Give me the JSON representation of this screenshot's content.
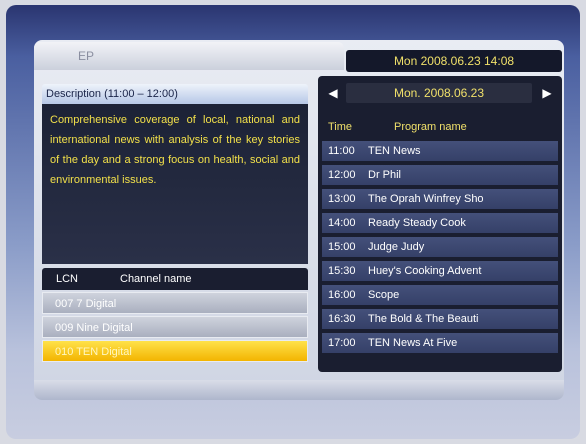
{
  "header": {
    "tab_label": "EP",
    "datetime": "Mon  2008.06.23  14:08"
  },
  "description": {
    "header": "Description (11:00 – 12:00)",
    "text": "Comprehensive coverage of local, national and international news with analysis of the key stories of the day and a strong focus on health, social and environmental issues."
  },
  "channels": {
    "columns": [
      "LCN",
      "Channel name"
    ],
    "rows": [
      {
        "label": "007  7 Digital"
      },
      {
        "label": "009  Nine Digital"
      },
      {
        "label": "010  TEN Digital"
      }
    ]
  },
  "guide": {
    "date": "Mon.    2008.06.23",
    "columns": [
      "Time",
      "Program name"
    ],
    "programs": [
      {
        "time": "11:00",
        "name": "TEN News"
      },
      {
        "time": "12:00",
        "name": "Dr Phil"
      },
      {
        "time": "13:00",
        "name": "The Oprah Winfrey Sho"
      },
      {
        "time": "14:00",
        "name": "Ready Steady Cook"
      },
      {
        "time": "15:00",
        "name": "Judge Judy"
      },
      {
        "time": "15:30",
        "name": "Huey's Cooking Advent"
      },
      {
        "time": "16:00",
        "name": "Scope"
      },
      {
        "time": "16:30",
        "name": "The Bold & The Beauti"
      },
      {
        "time": "17:00",
        "name": "TEN News At Five"
      }
    ]
  },
  "icons": {
    "prev": "left-arrow-icon",
    "next": "right-arrow-icon"
  }
}
